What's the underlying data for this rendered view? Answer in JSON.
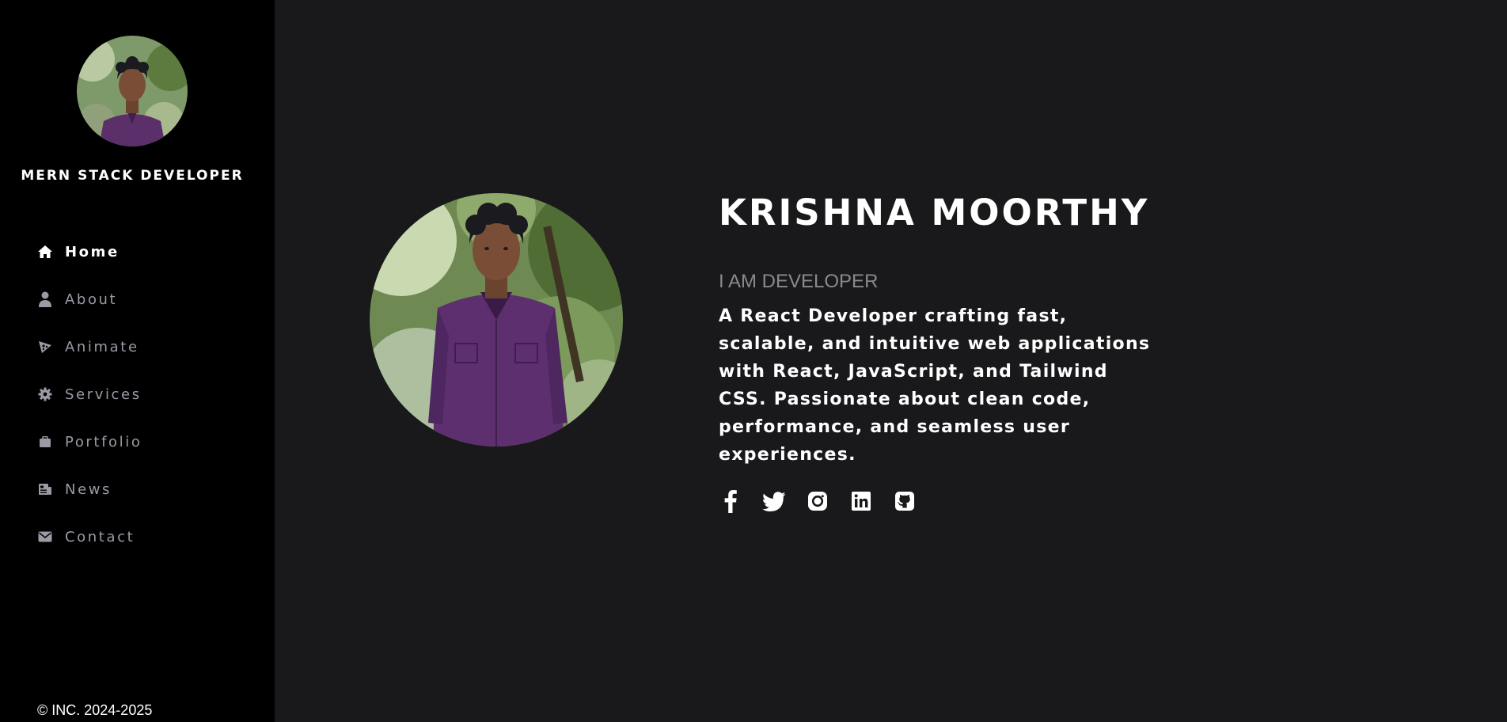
{
  "sidebar": {
    "role": "MERN STACK DEVELOPER",
    "avatar_icon": "profile-photo",
    "nav": [
      {
        "label": "Home",
        "icon": "home-icon",
        "active": true
      },
      {
        "label": "About",
        "icon": "user-icon",
        "active": false
      },
      {
        "label": "Animate",
        "icon": "pizza-slice-icon",
        "active": false
      },
      {
        "label": "Services",
        "icon": "gear-icon",
        "active": false
      },
      {
        "label": "Portfolio",
        "icon": "briefcase-icon",
        "active": false
      },
      {
        "label": "News",
        "icon": "newspaper-icon",
        "active": false
      },
      {
        "label": "Contact",
        "icon": "envelope-icon",
        "active": false
      }
    ],
    "copyright": "© INC. 2024-2025"
  },
  "hero": {
    "name": "KRISHNA MOORTHY",
    "tagline": "I AM DEVELOPER",
    "bio": "A React Developer crafting fast, scalable, and intuitive web applications with React, JavaScript, and Tailwind CSS. Passionate about clean code, performance, and seamless user experiences.",
    "socials": [
      "facebook-icon",
      "twitter-icon",
      "instagram-icon",
      "linkedin-icon",
      "github-icon"
    ]
  },
  "colors": {
    "sidebar_bg": "#000000",
    "main_bg": "#19191b",
    "nav_inactive": "#9a9ba5",
    "tagline": "#8a8a8e",
    "text": "#ffffff"
  }
}
